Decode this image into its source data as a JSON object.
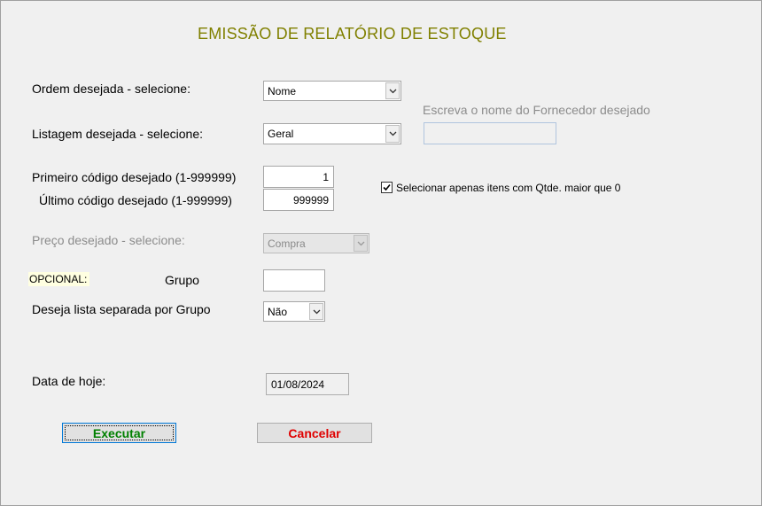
{
  "title": "EMISSÃO DE RELATÓRIO DE ESTOQUE",
  "ordem": {
    "label": "Ordem desejada - selecione:",
    "value": "Nome"
  },
  "listagem": {
    "label": "Listagem desejada - selecione:",
    "value": "Geral"
  },
  "fornecedor": {
    "label": "Escreva o nome do Fornecedor desejado",
    "value": ""
  },
  "primeiro": {
    "label": "Primeiro código desejado  (1-999999)",
    "value": "1"
  },
  "ultimo": {
    "label": "Último  código  desejado (1-999999)",
    "value": "999999"
  },
  "qtde_check": {
    "label": "Selecionar apenas itens com Qtde. maior que 0",
    "checked": true
  },
  "preco": {
    "label": "Preço desejado - selecione:",
    "value": "Compra"
  },
  "opcional_label": "OPCIONAL:",
  "grupo": {
    "label": "Grupo",
    "value": ""
  },
  "lista_grupo": {
    "label": "Deseja lista separada por Grupo",
    "value": "Não"
  },
  "data": {
    "label": "Data de hoje:",
    "value": "01/08/2024"
  },
  "buttons": {
    "execute": "Executar",
    "cancel": "Cancelar"
  },
  "colors": {
    "title": "#808000",
    "execute_text": "#008000",
    "cancel_text": "#e00000",
    "optional_bg": "#ffffe1"
  },
  "icons": {
    "dropdown": "chevron-down-icon",
    "check": "checkmark-icon"
  }
}
